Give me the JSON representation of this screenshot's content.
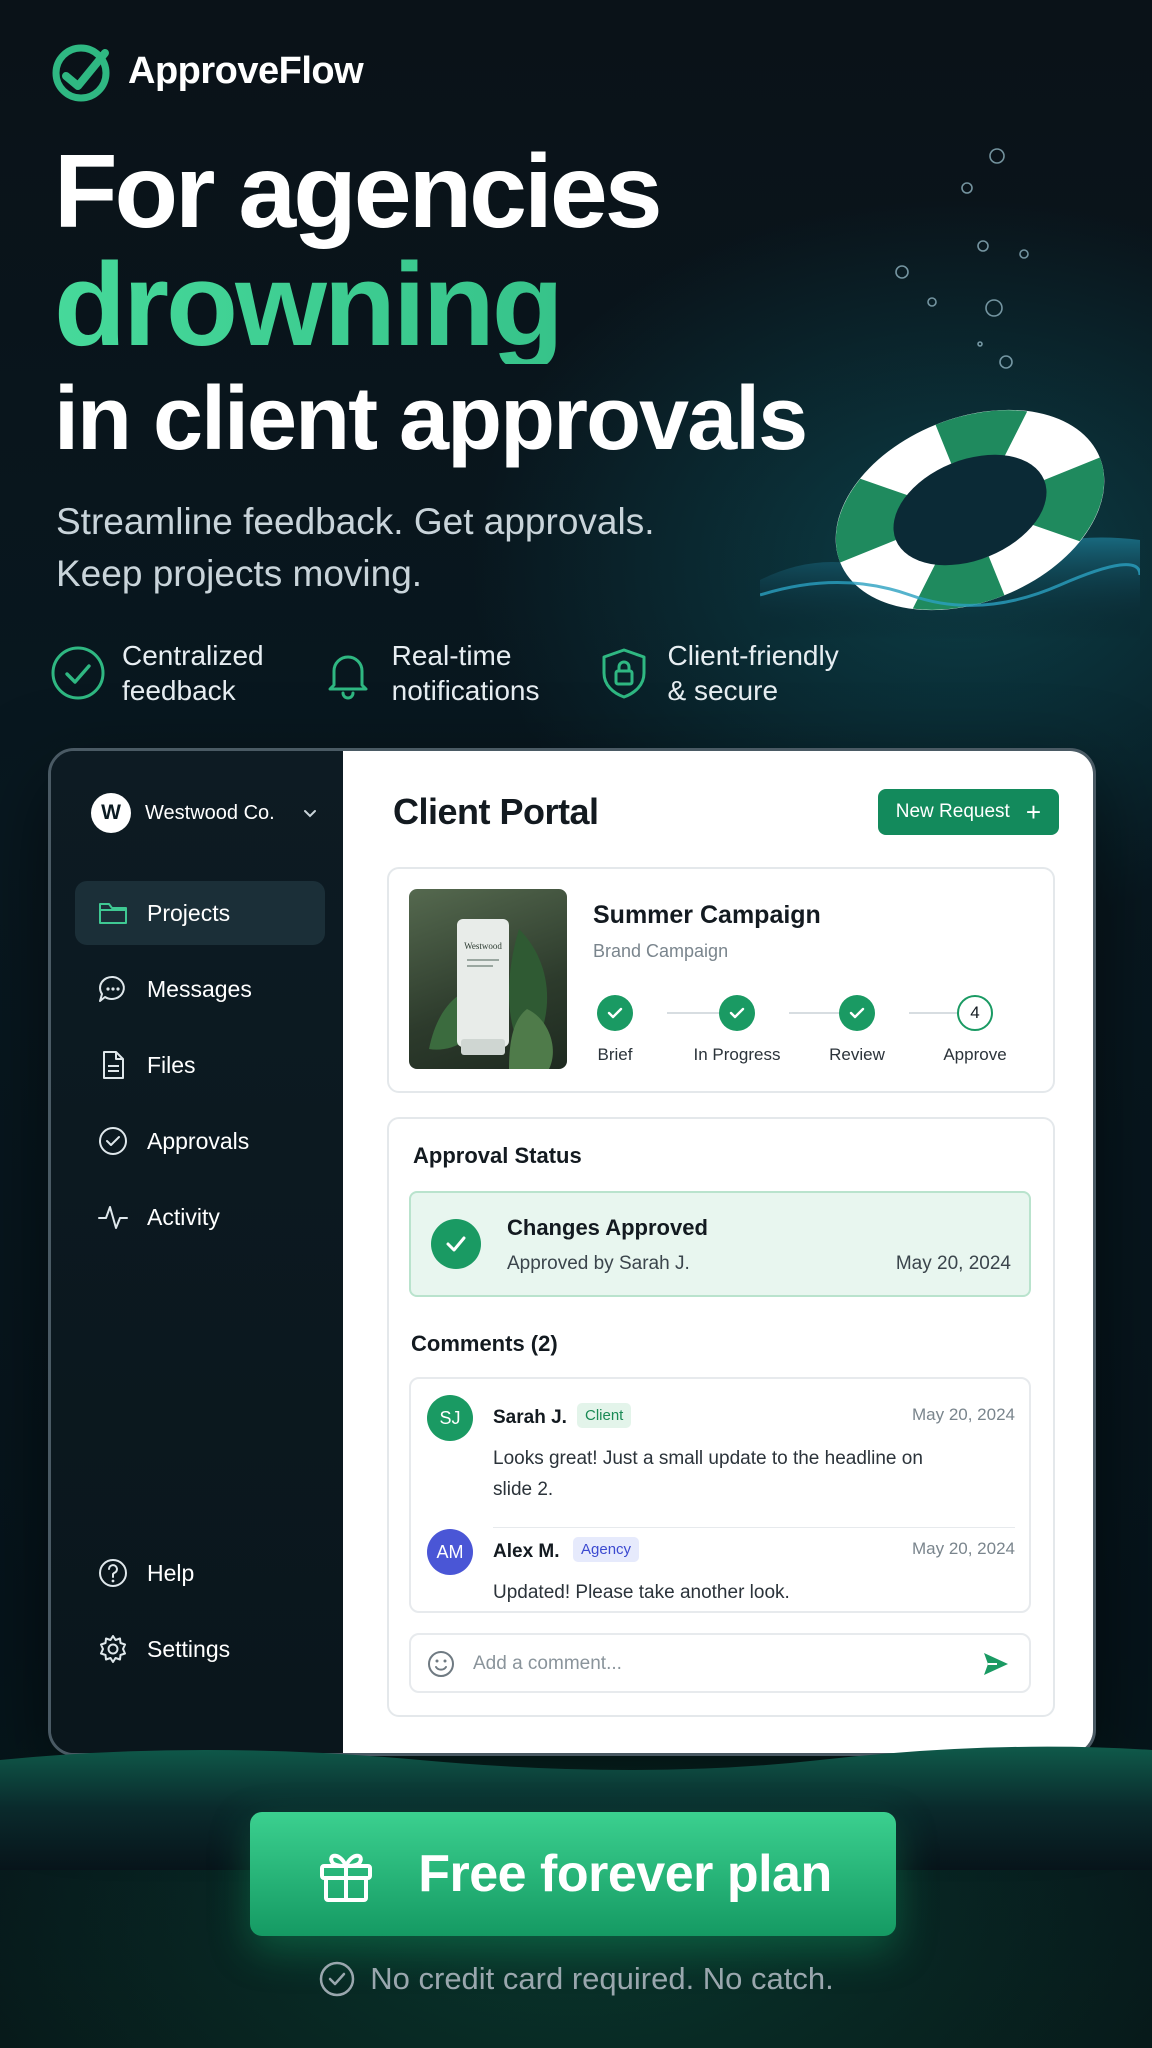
{
  "brand": {
    "name": "ApproveFlow",
    "accent": "#2fb882"
  },
  "hero": {
    "line1": "For agencies",
    "line2": "drowning",
    "line3": "in client approvals",
    "subtitle_1": "Streamline feedback. Get approvals.",
    "subtitle_2": "Keep projects moving."
  },
  "features": [
    {
      "icon": "check-circle-icon",
      "line1": "Centralized",
      "line2": "feedback"
    },
    {
      "icon": "bell-icon",
      "line1": "Real-time",
      "line2": "notifications"
    },
    {
      "icon": "shield-lock-icon",
      "line1": "Client-friendly",
      "line2": "& secure"
    }
  ],
  "sidebar": {
    "workspace_initial": "W",
    "workspace_name": "Westwood Co.",
    "items": [
      {
        "label": "Projects",
        "icon": "folder-icon",
        "active": true
      },
      {
        "label": "Messages",
        "icon": "chat-icon"
      },
      {
        "label": "Files",
        "icon": "file-icon"
      },
      {
        "label": "Approvals",
        "icon": "check-circle-icon"
      },
      {
        "label": "Activity",
        "icon": "activity-icon"
      }
    ],
    "bottom": [
      {
        "label": "Help",
        "icon": "help-icon"
      },
      {
        "label": "Settings",
        "icon": "gear-icon"
      }
    ]
  },
  "main": {
    "title": "Client Portal",
    "new_request_label": "New Request",
    "project": {
      "thumb_brand": "Westwood",
      "name": "Summer Campaign",
      "type": "Brand Campaign",
      "steps": [
        {
          "label": "Brief",
          "done": true
        },
        {
          "label": "In Progress",
          "done": true
        },
        {
          "label": "Review",
          "done": true
        },
        {
          "label": "Approve",
          "number": "4",
          "done": false
        }
      ]
    },
    "approval": {
      "title": "Approval Status",
      "status": "Changes Approved",
      "by": "Approved by Sarah J.",
      "date": "May 20, 2024"
    },
    "comments": {
      "title": "Comments (2)",
      "items": [
        {
          "initials": "SJ",
          "name": "Sarah J.",
          "badge": "Client",
          "date": "May 20, 2024",
          "text": "Looks great! Just a small update to the headline on slide 2.",
          "color": "#1a9a63"
        },
        {
          "initials": "AM",
          "name": "Alex M.",
          "badge": "Agency",
          "date": "May 20, 2024",
          "text": "Updated! Please take another look.",
          "color": "#4a56d6"
        }
      ],
      "input_placeholder": "Add a comment..."
    }
  },
  "cta": {
    "label": "Free forever plan",
    "note": "No credit card required. No catch."
  }
}
